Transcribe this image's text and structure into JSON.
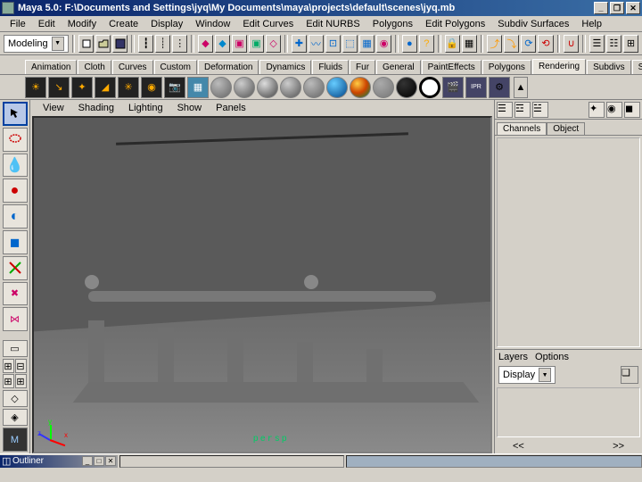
{
  "window": {
    "title": "Maya 5.0: F:\\Documents and Settings\\jyq\\My Documents\\maya\\projects\\default\\scenes\\jyq.mb",
    "min": "_",
    "max": "❐",
    "close": "✕"
  },
  "menu": [
    "File",
    "Edit",
    "Modify",
    "Create",
    "Display",
    "Window",
    "Edit Curves",
    "Edit NURBS",
    "Polygons",
    "Edit Polygons",
    "Subdiv Surfaces",
    "Help"
  ],
  "modeling_dropdown": "Modeling",
  "shelf_tabs": [
    "Animation",
    "Cloth",
    "Curves",
    "Custom",
    "Deformation",
    "Dynamics",
    "Fluids",
    "Fur",
    "General",
    "PaintEffects",
    "Polygons",
    "Rendering",
    "Subdivs",
    "Surfaces"
  ],
  "shelf_active": "Rendering",
  "view_menu": [
    "View",
    "Shading",
    "Lighting",
    "Show",
    "Panels"
  ],
  "viewport_label": "persp",
  "axis": {
    "x": "x",
    "y": "y",
    "z": "z"
  },
  "channel_tabs": [
    "Channels",
    "Object"
  ],
  "channel_active": "Channels",
  "layers": {
    "hdr1": "Layers",
    "hdr2": "Options",
    "display": "Display"
  },
  "slider": {
    "left": "<<",
    "right": ">>"
  },
  "outliner": "Outliner",
  "icons": {
    "arrow": "↖",
    "lasso": "◯",
    "paint": "💧",
    "sphere": "●",
    "cube": "◼",
    "move": "✥",
    "scale": "◆",
    "layers": "☰"
  },
  "shelf_balls": [
    "#888",
    "#888",
    "#888",
    "#888",
    "#888",
    "#0af",
    "#f80",
    "#888",
    "#000",
    "#fff"
  ]
}
